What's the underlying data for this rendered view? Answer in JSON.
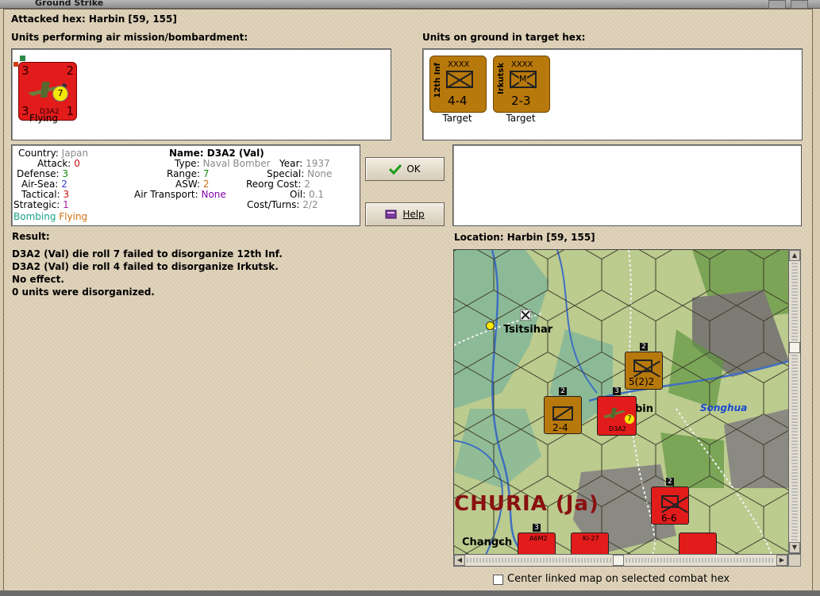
{
  "window": {
    "title": "Ground Strike"
  },
  "header": {
    "attacked_hex": "Attacked hex: Harbin  [59, 155]"
  },
  "air_units": {
    "label": "Units performing air mission/bombardment:",
    "units": [
      {
        "name": "D3A2",
        "top_left": "3",
        "top_right": "2",
        "bottom_left": "3",
        "bottom_right": "1",
        "badge": "7",
        "status": "Flying"
      }
    ]
  },
  "ground_units": {
    "label": "Units on ground in target hex:",
    "units": [
      {
        "name": "12th Inf",
        "size": "XXXX",
        "strength": "4-4",
        "status": "Target"
      },
      {
        "name": "Irkutsk",
        "size": "XXXX",
        "symbol": "M",
        "strength": "2-3",
        "status": "Target"
      }
    ]
  },
  "details": {
    "country_label": "Country:",
    "country": "Japan",
    "attack_label": "Attack:",
    "attack": "0",
    "defense_label": "Defense:",
    "defense": "3",
    "airsea_label": "Air-Sea:",
    "airsea": "2",
    "tactical_label": "Tactical:",
    "tactical": "3",
    "strategic_label": "Strategic:",
    "strategic": "1",
    "mission": "Bombing",
    "state": "Flying",
    "name_label": "Name:",
    "name": "D3A2 (Val)",
    "type_label": "Type:",
    "type": "Naval Bomber",
    "range_label": "Range:",
    "range": "7",
    "asw_label": "ASW:",
    "asw": "2",
    "air_transport_label": "Air Transport:",
    "air_transport": "None",
    "year_label": "Year:",
    "year": "1937",
    "special_label": "Special:",
    "special": "None",
    "reorg_label": "Reorg Cost:",
    "reorg": "2",
    "oil_label": "Oil:",
    "oil": "0.1",
    "cost_label": "Cost/Turns:",
    "cost": "2/2"
  },
  "buttons": {
    "ok": "OK",
    "help": "Help"
  },
  "result": {
    "label": "Result:",
    "lines": [
      "D3A2 (Val) die roll 7 failed to disorganize 12th Inf.",
      "D3A2 (Val) die roll 4 failed to disorganize Irkutsk.",
      "No effect.",
      "0 units were disorganized."
    ]
  },
  "location": {
    "label": "Location:  Harbin  [59, 155]",
    "map": {
      "city": "Tsitsihar",
      "city2_partial": "bin",
      "river": "Songhua",
      "region": "CHURIA (Ja)",
      "city3": "Changch",
      "counters": [
        {
          "id": "irkutsk",
          "strength": "5(2)2",
          "stack": "2"
        },
        {
          "id": "cav",
          "strength": "2-4",
          "stack": "2"
        },
        {
          "id": "d3a2",
          "label": "D3A2",
          "badge": "7",
          "stack": "3"
        },
        {
          "id": "red-corps",
          "strength": "6-6",
          "stack": "2"
        },
        {
          "id": "a6m2",
          "label": "A6M2",
          "stack": "3"
        },
        {
          "id": "ki27",
          "label": "Ki-27"
        }
      ]
    },
    "center_checkbox": "Center linked map on selected combat hex"
  },
  "colors": {
    "red_unit": "#e21b1b",
    "soviet_unit": "#b8790c",
    "attack": "#d01010",
    "defense": "#0a8a0a",
    "airsea": "#3a3ad0",
    "strategic": "#a020a0",
    "bombing": "#18a088",
    "flying": "#d07010",
    "range": "#0a8a0a",
    "asw": "#d07010",
    "air_transport": "#8000b0"
  }
}
